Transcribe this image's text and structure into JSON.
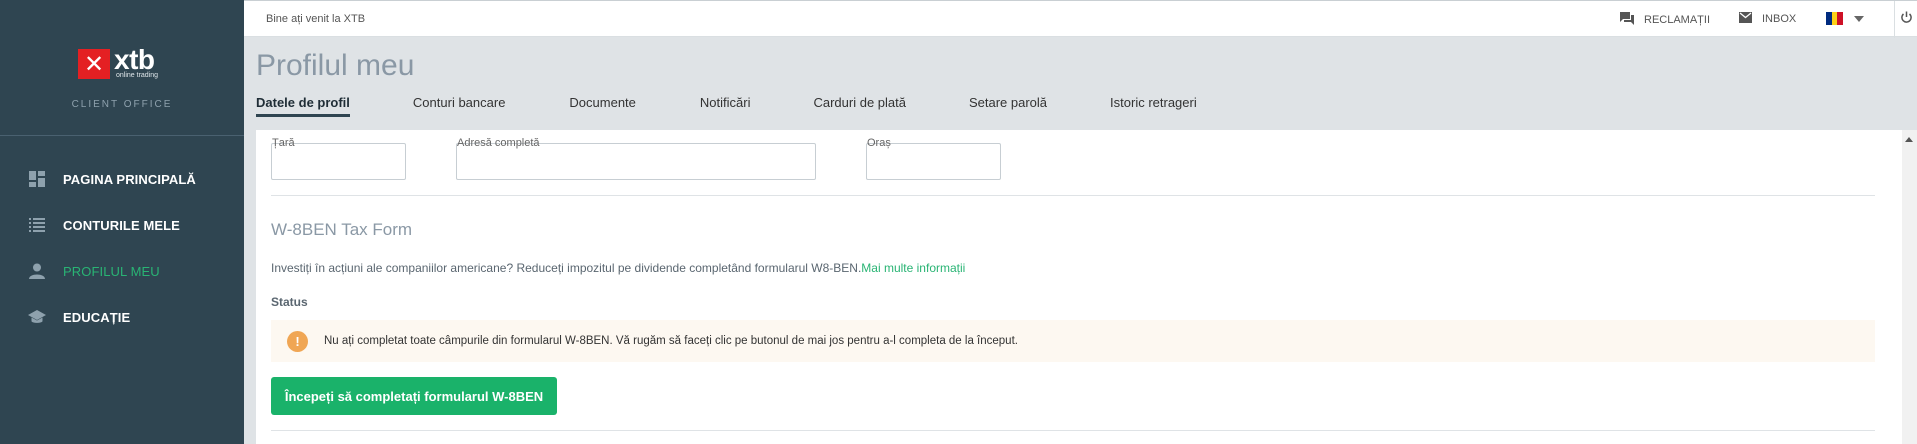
{
  "sidebar": {
    "logo": {
      "brand": "xtb",
      "tagline": "online trading"
    },
    "client_office": "CLIENT OFFICE",
    "items": [
      {
        "label": "PAGINA PRINCIPALĂ",
        "icon": "dashboard-icon",
        "active": false
      },
      {
        "label": "CONTURILE MELE",
        "icon": "list-icon",
        "active": false
      },
      {
        "label": "PROFILUL MEU",
        "icon": "user-icon",
        "active": true
      },
      {
        "label": "EDUCAȚIE",
        "icon": "graduation-cap-icon",
        "active": false
      }
    ]
  },
  "topbar": {
    "welcome": "Bine ați venit la XTB",
    "complaints_label": "RECLAMAȚII",
    "inbox_label": "INBOX",
    "language_flag": [
      "#002B7F",
      "#FCD116",
      "#CE1126"
    ]
  },
  "page": {
    "title": "Profilul meu",
    "tabs": [
      {
        "label": "Datele de profil",
        "active": true
      },
      {
        "label": "Conturi bancare",
        "active": false
      },
      {
        "label": "Documente",
        "active": false
      },
      {
        "label": "Notificări",
        "active": false
      },
      {
        "label": "Carduri de plată",
        "active": false
      },
      {
        "label": "Setare parolă",
        "active": false
      },
      {
        "label": "Istoric retrageri",
        "active": false
      }
    ]
  },
  "form": {
    "country_label": "Țară",
    "address_label": "Adresă completă",
    "city_label": "Oraș",
    "country_value": "",
    "address_value": "",
    "city_value": ""
  },
  "w8ben": {
    "title": "W-8BEN Tax Form",
    "info_text": "Investiți în acțiuni ale companiilor americane? Reduceți impozitul pe dividende completând formularul W8-BEN.",
    "info_link": "Mai multe informații",
    "status_label": "Status",
    "warning_text": "Nu ați completat toate câmpurile din formularul W-8BEN. Vă rugăm să faceți clic pe butonul de mai jos pentru a-l completa de la început.",
    "warning_icon": "!",
    "button_label": "Începeți să completați formularul W-8BEN"
  },
  "colors": {
    "sidebar_bg": "#2f4551",
    "accent_green": "#1ab26a",
    "warning_orange": "#f0a654",
    "brand_red": "#e42023"
  }
}
